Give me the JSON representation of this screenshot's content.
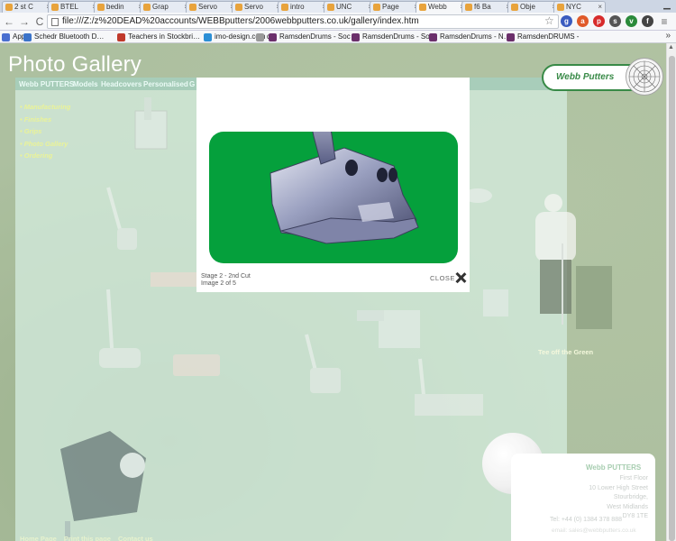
{
  "browser": {
    "tabs": [
      {
        "label": "2 st C",
        "active": false
      },
      {
        "label": "BTEL",
        "active": false
      },
      {
        "label": "bedin",
        "active": false
      },
      {
        "label": "Grap",
        "active": false
      },
      {
        "label": "Servo",
        "active": false
      },
      {
        "label": "Servo",
        "active": false
      },
      {
        "label": "intro",
        "active": false
      },
      {
        "label": "UNC",
        "active": false
      },
      {
        "label": "Page",
        "active": false
      },
      {
        "label": "Webb",
        "active": true
      },
      {
        "label": "f6 Ba",
        "active": false
      },
      {
        "label": "Obje",
        "active": false
      },
      {
        "label": "NYC",
        "active": false
      }
    ],
    "tab_close_glyph": "×",
    "url": "file:///Z:/z%20DEAD%20accounts/WEBBputters/2006webbputters.co.uk/gallery/index.htm",
    "bookmarks": [
      {
        "label": "Apps",
        "color": "#4a6fd0"
      },
      {
        "label": "Schedr Bluetooth D…",
        "color": "#3b73c9"
      },
      {
        "label": "Teachers in Stockbri…",
        "color": "#c0392b"
      },
      {
        "label": "imo-design.com",
        "color": "#2c8fd6"
      },
      {
        "label": "q",
        "color": "#999999"
      },
      {
        "label": "RamsdenDrums - Soc",
        "color": "#6b2f6b"
      },
      {
        "label": "RamsdenDrums - Soc",
        "color": "#6b2f6b"
      },
      {
        "label": "RamsdenDrums - N…",
        "color": "#6b2f6b"
      },
      {
        "label": "RamsdenDRUMS -",
        "color": "#6b2f6b"
      }
    ],
    "bookmarks_more": "»",
    "nav": {
      "back": "←",
      "forward": "→",
      "reload": "C",
      "menu": "≡"
    },
    "extensions": [
      {
        "label": "g",
        "color": "#3a5bbf"
      },
      {
        "label": "a",
        "color": "#e05a2a"
      },
      {
        "label": "p",
        "color": "#d72b2b"
      },
      {
        "label": "s",
        "color": "#555555"
      },
      {
        "label": "v",
        "color": "#2a8a3a"
      },
      {
        "label": "f",
        "color": "#444444"
      }
    ],
    "star": "☆"
  },
  "site": {
    "title": "Photo Gallery",
    "topnav": [
      "Webb PUTTERS",
      "Models",
      "Headcovers",
      "Personalised",
      "G"
    ],
    "sidenav": [
      "Manufacturing",
      "Finishes",
      "Grips",
      "Photo Gallery",
      "Ordering"
    ],
    "logo_text": "Webb Putters",
    "tee_caption": "Tee off the Green",
    "contact": {
      "name": "Webb PUTTERS",
      "address_lines": [
        "First Floor",
        "10 Lower High Street",
        "Stourbridge,",
        "West Midlands",
        "DY8 1TE"
      ],
      "tel": "Tel: +44 (0) 1384 378 888",
      "email": "email: sales@webbputters.co.uk"
    },
    "footer_links": [
      "Home Page",
      "Print this page",
      "Contact us"
    ]
  },
  "lightbox": {
    "caption_title": "Stage 2 - 2nd Cut",
    "caption_counter": "Image 2 of 5",
    "close_label": "CLOSE",
    "bg_color": "#05a03c"
  }
}
